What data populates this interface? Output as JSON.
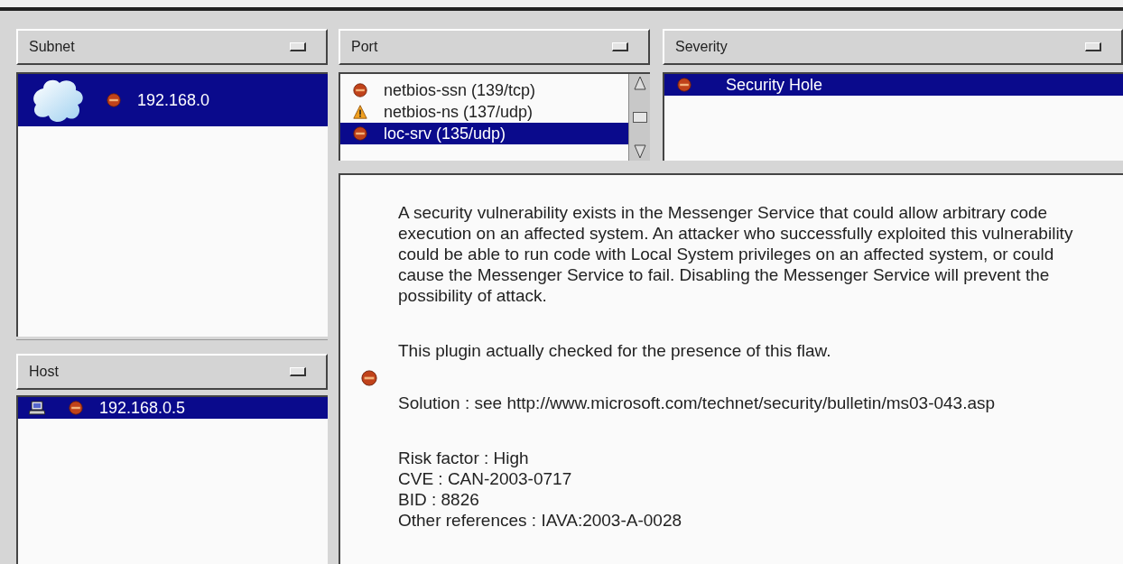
{
  "subnet": {
    "title": "Subnet",
    "items": [
      {
        "label": "192.168.0",
        "kind": "hole",
        "selected": true
      }
    ]
  },
  "host": {
    "title": "Host",
    "items": [
      {
        "label": "192.168.0.5",
        "kind": "hole",
        "selected": true
      }
    ]
  },
  "port": {
    "title": "Port",
    "items": [
      {
        "label": "netbios-ssn (139/tcp)",
        "kind": "hole",
        "selected": false
      },
      {
        "label": "netbios-ns (137/udp)",
        "kind": "warning",
        "selected": false
      },
      {
        "label": "loc-srv (135/udp)",
        "kind": "hole",
        "selected": true
      }
    ]
  },
  "severity": {
    "title": "Severity",
    "items": [
      {
        "label": "Security Hole",
        "kind": "hole",
        "selected": true
      }
    ]
  },
  "report": {
    "kind": "hole",
    "description": "A security vulnerability exists in the Messenger Service that could allow arbitrary code execution on an affected system. An attacker who successfully exploited this vulnerability could be able to run code with Local System privileges on an affected system, or could cause the Messenger Service to fail. Disabling the Messenger Service will prevent the possibility of attack.",
    "note": "This plugin actually checked for the presence of this flaw.",
    "solution": "Solution : see http://www.microsoft.com/technet/security/bulletin/ms03-043.asp",
    "facts": [
      "Risk factor : High",
      "CVE : CAN-2003-0717",
      "BID : 8826",
      "Other references : IAVA:2003-A-0028"
    ]
  }
}
